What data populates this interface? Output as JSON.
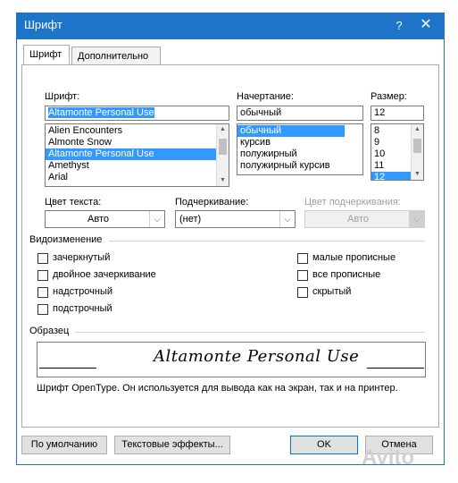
{
  "window": {
    "title": "Шрифт",
    "help": "?",
    "close": "✕"
  },
  "tabs": [
    {
      "label": "Шрифт",
      "active": true
    },
    {
      "label": "Дополнительно",
      "active": false
    }
  ],
  "font": {
    "label": "Шрифт:",
    "value": "Altamonte Personal Use",
    "list": [
      "Alien Encounters",
      "Almonte Snow",
      "Altamonte Personal Use",
      "Amethyst",
      "Arial"
    ],
    "selected": "Altamonte Personal Use"
  },
  "style": {
    "label": "Начертание:",
    "value": "обычный",
    "list": [
      "обычный",
      "курсив",
      "полужирный",
      "полужирный курсив"
    ],
    "selected": "обычный"
  },
  "size": {
    "label": "Размер:",
    "value": "12",
    "list": [
      "8",
      "9",
      "10",
      "11",
      "12"
    ],
    "selected": "12"
  },
  "text_color": {
    "label": "Цвет текста:",
    "value": "Авто"
  },
  "underline": {
    "label": "Подчеркивание:",
    "value": "(нет)"
  },
  "underline_color": {
    "label": "Цвет подчеркивания:",
    "value": "Авто"
  },
  "effects": {
    "label": "Видоизменение",
    "left": [
      {
        "label": "зачеркнутый",
        "checked": false
      },
      {
        "label": "двойное зачеркивание",
        "checked": false
      },
      {
        "label": "надстрочный",
        "checked": false
      },
      {
        "label": "подстрочный",
        "checked": false
      }
    ],
    "right": [
      {
        "label": "малые прописные",
        "checked": false
      },
      {
        "label": "все прописные",
        "checked": false
      },
      {
        "label": "скрытый",
        "checked": false
      }
    ]
  },
  "preview": {
    "label": "Образец",
    "sample": "Altamonte Personal Use",
    "description": "Шрифт OpenType. Он используется для вывода как на экран, так и на принтер."
  },
  "buttons": {
    "default": "По умолчанию",
    "text_effects": "Текстовые эффекты...",
    "ok": "OK",
    "cancel": "Отмена"
  },
  "watermark": "Avito",
  "colors": {
    "titlebar": "#1e74c8",
    "selection": "#3399ff"
  }
}
